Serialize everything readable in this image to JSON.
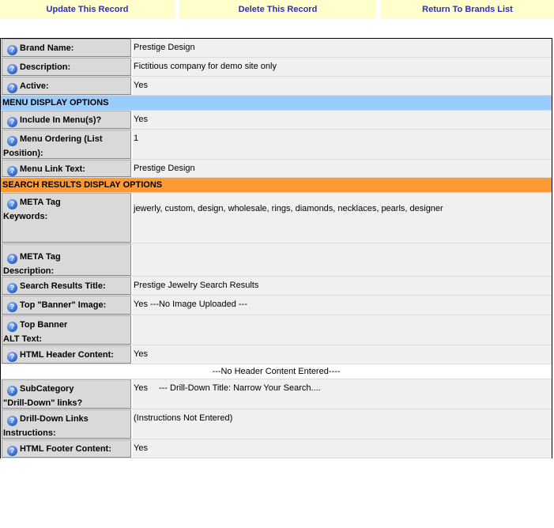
{
  "top_actions": {
    "update": "Update This Record",
    "delete": "Delete This Record",
    "return": "Return To Brands List"
  },
  "icon": {
    "help_icon": "question-mark-icon",
    "symbol": "?"
  },
  "fields": {
    "brand_name": {
      "label": "Brand Name:",
      "value": "Prestige Design"
    },
    "description": {
      "label": "Description:",
      "value": "Fictitious company for demo site only"
    },
    "active": {
      "label": "Active:",
      "value": "Yes"
    }
  },
  "menu_section": {
    "title": "MENU DISPLAY OPTIONS",
    "color": "#99ccff",
    "include": {
      "label": "Include In Menu(s)?",
      "value": "Yes"
    },
    "ordering": {
      "label_line1": "Menu Ordering (List",
      "label_line2": "Position):",
      "value": "1"
    },
    "link_text": {
      "label": "Menu Link Text:",
      "value": "Prestige Design"
    }
  },
  "search_section": {
    "title": "SEARCH RESULTS DISPLAY OPTIONS",
    "color": "#ff9933",
    "meta_keywords": {
      "label_line1": "META Tag",
      "label_line2": "Keywords:",
      "value": "jewerly, custom, design, wholesale, rings, diamonds, necklaces, pearls, designer"
    },
    "meta_description": {
      "label_line1": "META Tag",
      "label_line2": "Description:",
      "value": ""
    },
    "results_title": {
      "label": "Search Results Title:",
      "value": "Prestige Jewelry Search Results"
    },
    "banner_image": {
      "label": "Top \"Banner\" Image:",
      "value": "Yes ---No Image Uploaded ---"
    },
    "banner_alt": {
      "label_line1": "Top Banner",
      "label_line2": "ALT Text:",
      "value": ""
    },
    "header_content": {
      "label": "HTML Header Content:",
      "value": "Yes"
    },
    "header_note": "---No Header Content Entered----",
    "subcategory": {
      "label_line1": "SubCategory",
      "label_line2": "\"Drill-Down\" links?",
      "value_yes": "Yes",
      "value_detail": "--- Drill-Down Title: Narrow Your Search...."
    },
    "drilldown_instr": {
      "label_line1": "Drill-Down Links",
      "label_line2": "Instructions:",
      "value": "(Instructions Not Entered)"
    },
    "footer_content": {
      "label": "HTML Footer Content:",
      "value": "Yes"
    }
  }
}
